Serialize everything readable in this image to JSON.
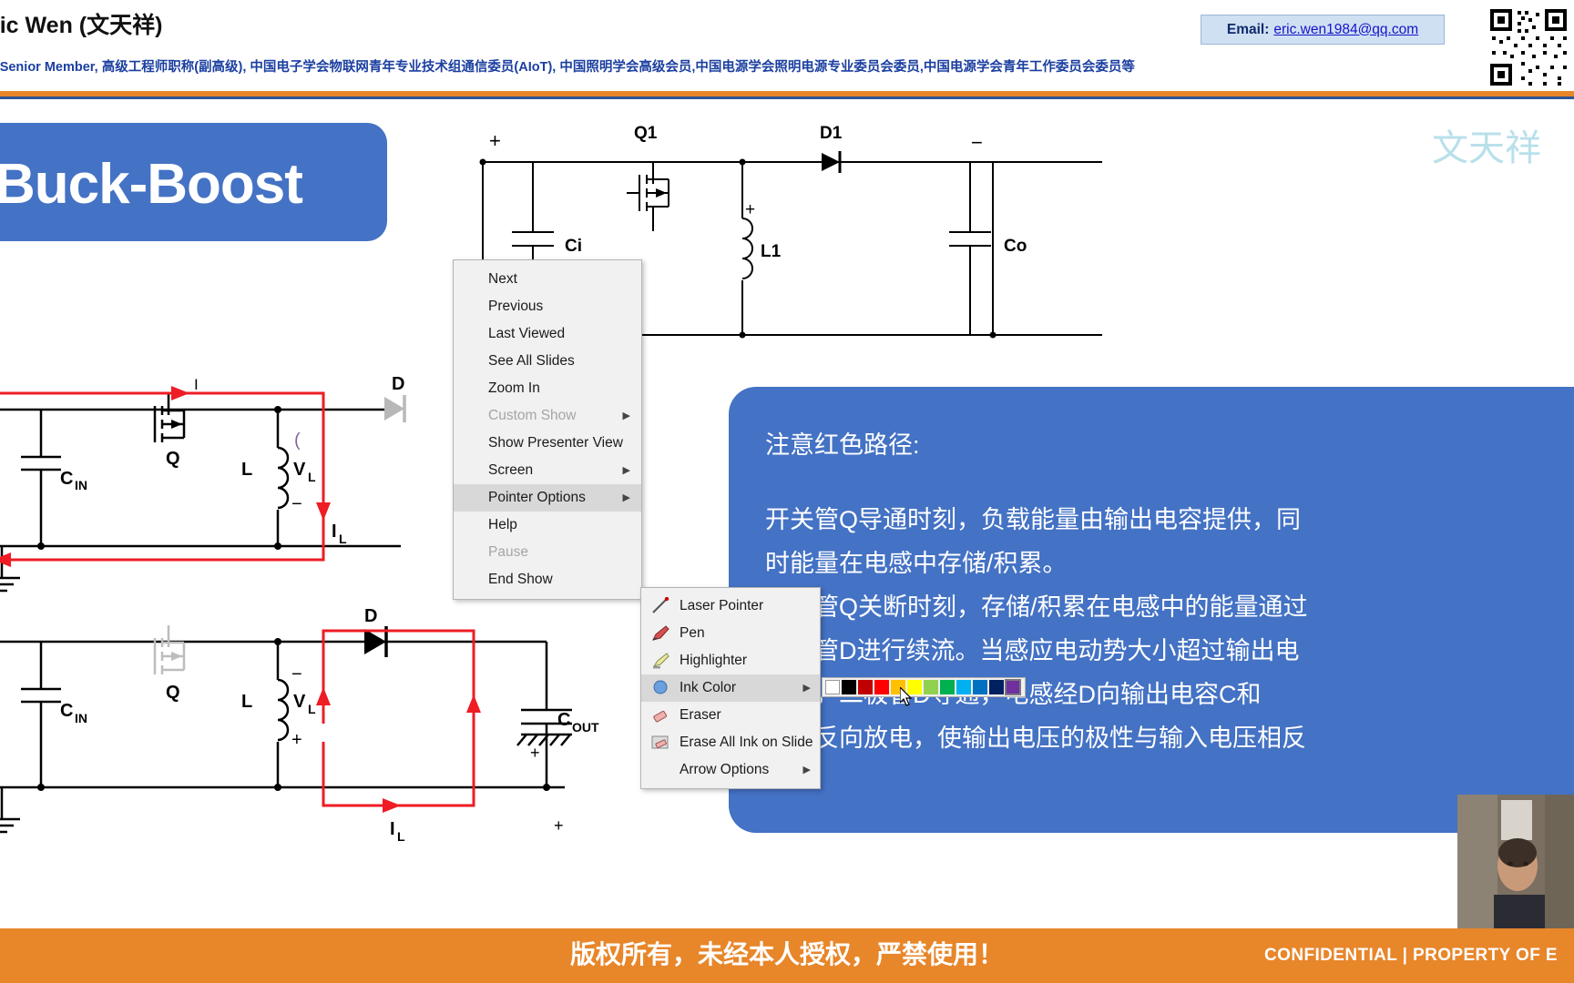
{
  "header": {
    "presenter_name": "ric Wen (文天祥)",
    "credentials": "E Senior Member, 高级工程师职称(副高级), 中国电子学会物联网青年专业技术组通信委员(AIoT), 中国照明学会高级会员,中国电源学会照明电源专业委员会委员,中国电源学会青年工作委员会委员等",
    "email_label": "Email:",
    "email_address": "eric.wen1984@qq.com"
  },
  "slide": {
    "title": "Buck-Boost",
    "watermark": "文天祥",
    "explanation_lines": [
      "注意红色路径:",
      "",
      "开关管Q导通时刻，负载能量由输出电容提供，同",
      "时能量在电感中存储/积累。",
      "开关管Q关断时刻，存储/积累在电感中的能量通过",
      "二极管D进行续流。当感应电动势大小超过输出电",
      "压时，二极管D导通，电感经D向输出电容C和",
      "负载反向放电，使输出电压的极性与输入电压相反"
    ],
    "circuit_top_labels": {
      "q1": "Q1",
      "d1": "D1",
      "ci": "Ci",
      "co": "Co",
      "l1": "L1",
      "plus_in": "+",
      "minus_out": "−",
      "plus_l": "+"
    },
    "circuit_mid_labels": {
      "current": "I",
      "cin": "C",
      "cin_sub": "IN",
      "q": "Q",
      "l": "L",
      "vl": "V",
      "vl_sub": "L",
      "il": "I",
      "il_sub": "L",
      "d": "D",
      "minus": "−",
      "plus": "+"
    },
    "circuit_bot_labels": {
      "cin": "C",
      "cin_sub": "IN",
      "q": "Q",
      "l": "L",
      "vl": "V",
      "vl_sub": "L",
      "il": "I",
      "il_sub": "L",
      "d": "D",
      "cout": "C",
      "cout_sub": "OUT",
      "minus": "−",
      "plus": "+"
    }
  },
  "context_menu": {
    "items": [
      {
        "label": "Next",
        "accel": "N",
        "disabled": false,
        "submenu": false,
        "selected": false
      },
      {
        "label": "Previous",
        "accel": "P",
        "disabled": false,
        "submenu": false,
        "selected": false
      },
      {
        "label": "Last Viewed",
        "accel": "V",
        "disabled": false,
        "submenu": false,
        "selected": false
      },
      {
        "label": "See All Slides",
        "accel": "A",
        "disabled": false,
        "submenu": false,
        "selected": false
      },
      {
        "label": "Zoom In",
        "accel": "I",
        "disabled": false,
        "submenu": false,
        "selected": false
      },
      {
        "label": "Custom Show",
        "accel": "w",
        "disabled": true,
        "submenu": true,
        "selected": false
      },
      {
        "label": "Show Presenter View",
        "accel": "",
        "disabled": false,
        "submenu": false,
        "selected": false
      },
      {
        "label": "Screen",
        "accel": "c",
        "disabled": false,
        "submenu": true,
        "selected": false
      },
      {
        "label": "Pointer Options",
        "accel": "o",
        "disabled": false,
        "submenu": true,
        "selected": true
      },
      {
        "label": "Help",
        "accel": "H",
        "disabled": false,
        "submenu": false,
        "selected": false
      },
      {
        "label": "Pause",
        "accel": "",
        "disabled": true,
        "submenu": false,
        "selected": false
      },
      {
        "label": "End Show",
        "accel": "E",
        "disabled": false,
        "submenu": false,
        "selected": false
      }
    ]
  },
  "pointer_submenu": {
    "items": [
      {
        "label": "Laser Pointer",
        "icon": "laser-pointer-icon",
        "submenu": false,
        "selected": false
      },
      {
        "label": "Pen",
        "icon": "pen-icon",
        "submenu": false,
        "selected": false
      },
      {
        "label": "Highlighter",
        "icon": "highlighter-icon",
        "submenu": false,
        "selected": false
      },
      {
        "label": "Ink Color",
        "icon": "ink-color-icon",
        "submenu": true,
        "selected": true
      },
      {
        "label": "Eraser",
        "icon": "eraser-icon",
        "submenu": false,
        "selected": false
      },
      {
        "label": "Erase All Ink on Slide",
        "icon": "erase-all-icon",
        "submenu": false,
        "selected": false
      },
      {
        "label": "Arrow Options",
        "icon": "arrow-options-icon",
        "submenu": true,
        "selected": false
      }
    ]
  },
  "ink_palette": {
    "swatches": [
      "#ffffff",
      "#000000",
      "#c00000",
      "#ff0000",
      "#ffc000",
      "#ffff00",
      "#92d050",
      "#00b050",
      "#00b0f0",
      "#0070c0",
      "#002060",
      "#7030a0"
    ],
    "active_index": 11
  },
  "footer": {
    "copyright_cn": "版权所有，未经本人授权，严禁使用！",
    "confidential": "CONFIDENTIAL  |  PROPERTY OF  E"
  },
  "colors": {
    "accent_orange": "#e8862a",
    "accent_blue": "#4472c4",
    "path_red": "#ee1c25",
    "link_blue": "#1414c8"
  }
}
